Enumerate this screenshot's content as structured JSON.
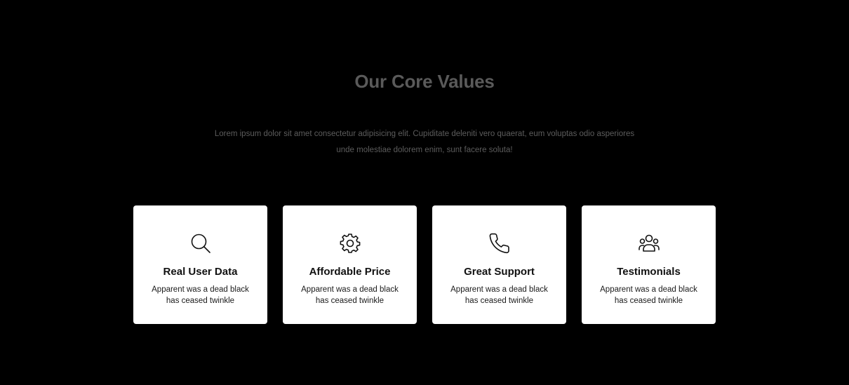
{
  "section": {
    "title": "Our Core Values",
    "description": "Lorem ipsum dolor sit amet consectetur adipisicing elit. Cupiditate deleniti vero quaerat, eum voluptas odio asperiores unde molestiae dolorem enim, sunt facere soluta!"
  },
  "cards": [
    {
      "icon": "search-icon",
      "title": "Real User Data",
      "description": "Apparent was a dead black has ceased twinkle"
    },
    {
      "icon": "gear-icon",
      "title": "Affordable Price",
      "description": "Apparent was a dead black has ceased twinkle"
    },
    {
      "icon": "phone-icon",
      "title": "Great Support",
      "description": "Apparent was a dead black has ceased twinkle"
    },
    {
      "icon": "users-icon",
      "title": "Testimonials",
      "description": "Apparent was a dead black has ceased twinkle"
    }
  ],
  "colors": {
    "background": "#000000",
    "card_background": "#ffffff",
    "title_text": "#5a5a5a",
    "description_text": "#5c5c5c",
    "card_text": "#111111"
  }
}
